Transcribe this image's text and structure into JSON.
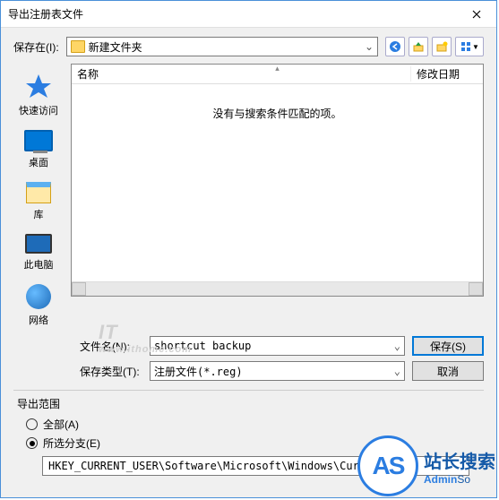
{
  "title": "导出注册表文件",
  "saveIn": {
    "label": "保存在(I):",
    "folder": "新建文件夹"
  },
  "sidebar": {
    "items": [
      {
        "label": "快速访问"
      },
      {
        "label": "桌面"
      },
      {
        "label": "库"
      },
      {
        "label": "此电脑"
      },
      {
        "label": "网络"
      }
    ]
  },
  "filelist": {
    "col_name": "名称",
    "col_date": "修改日期",
    "empty": "没有与搜索条件匹配的项。"
  },
  "form": {
    "filename_label": "文件名(N):",
    "filename_value": "shortcut backup",
    "filetype_label": "保存类型(T):",
    "filetype_value": "注册文件(*.reg)",
    "save": "保存(S)",
    "cancel": "取消"
  },
  "scope": {
    "title": "导出范围",
    "all": "全部(A)",
    "selected": "所选分支(E)",
    "branch": "HKEY_CURRENT_USER\\Software\\Microsoft\\Windows\\Curren"
  },
  "watermark": {
    "main": "IT",
    "sub": "www.ithome.com"
  },
  "logo": {
    "circle": "AS",
    "cn": "站长搜索",
    "en_pre": "Admin",
    "en_suf": "So"
  }
}
